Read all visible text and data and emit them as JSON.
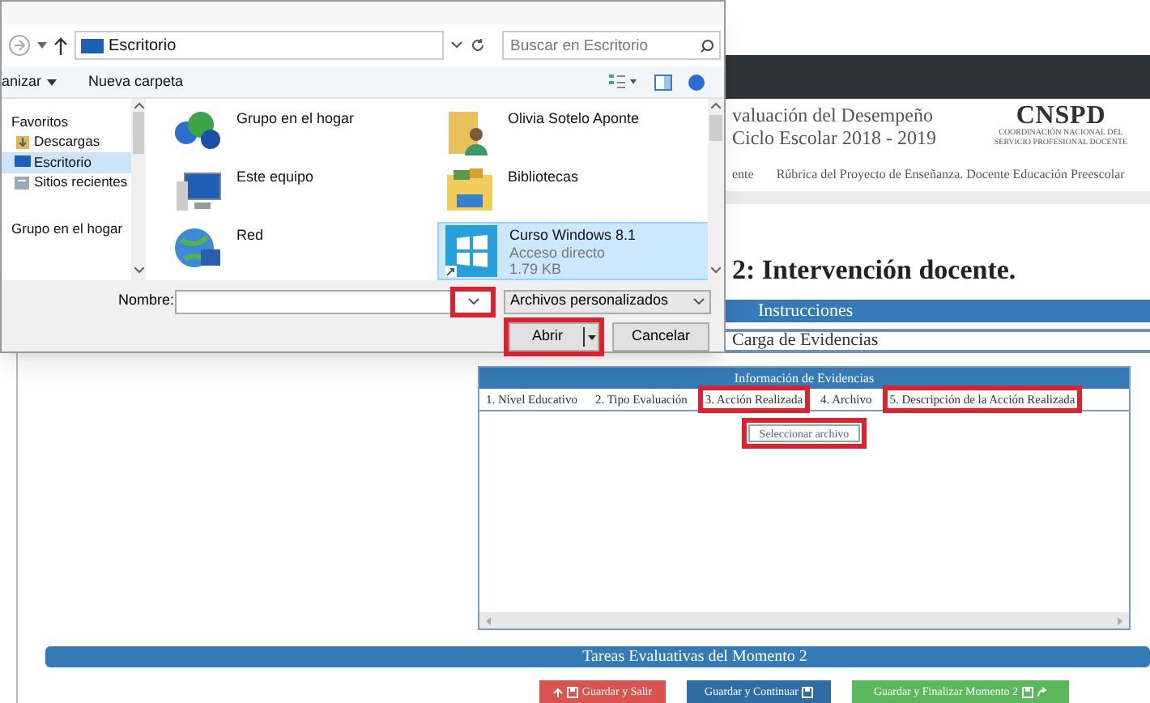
{
  "dialog": {
    "address": "Escritorio",
    "search": {
      "placeholder": "Buscar en Escritorio"
    },
    "toolbar": [
      "anizar",
      "Nueva carpeta"
    ],
    "nav_pane": [
      {
        "label": "Favoritos",
        "kind": "group",
        "selected": false
      },
      {
        "label": "Descargas",
        "kind": "download",
        "selected": false
      },
      {
        "label": "Escritorio",
        "kind": "desktop",
        "selected": true
      },
      {
        "label": "Sitios recientes",
        "kind": "recent",
        "selected": false
      },
      {
        "label": "Grupo en el hogar",
        "kind": "group",
        "selected": false
      }
    ],
    "files": [
      {
        "name": "Grupo en el hogar",
        "kind": "homegroup",
        "selected": false
      },
      {
        "name": "Olivia Sotelo Aponte",
        "kind": "user",
        "selected": false
      },
      {
        "name": "Este equipo",
        "kind": "computer",
        "selected": false
      },
      {
        "name": "Bibliotecas",
        "kind": "library",
        "selected": false
      },
      {
        "name": "Red",
        "kind": "network",
        "selected": false
      },
      {
        "name": "Curso Windows 8.1",
        "details": [
          "Acceso directo",
          "1.79 KB"
        ],
        "kind": "shortcut",
        "selected": true
      }
    ],
    "filename": {
      "label": "Nombre:",
      "dropdown_highlighted": true
    },
    "file_type": "Archivos personalizados",
    "buttons": [
      {
        "label": "Abrir",
        "kind": "split",
        "highlighted": true
      },
      {
        "label": "Cancelar",
        "kind": "plain",
        "highlighted": false
      }
    ]
  },
  "page": {
    "title_lines": [
      "valuación del Desempeño",
      "Ciclo Escolar 2018 - 2019"
    ],
    "logo": {
      "title": "CNSPD",
      "subtitle": [
        "COORDINACIÓN NACIONAL DEL",
        "SERVICIO PROFESIONAL DOCENTE"
      ]
    },
    "nav": [
      "ente",
      "Rúbrica del Proyecto de Enseñanza. Docente Educación Preescolar"
    ],
    "heading": "2: Intervención docente.",
    "sections": [
      {
        "label": "Instrucciones",
        "kind": "bar"
      },
      {
        "label": "Carga de Evidencias",
        "kind": "outline"
      }
    ],
    "evidence": {
      "title": "Información de Evidencias",
      "columns": [
        {
          "label": "1. Nivel Educativo",
          "highlighted": false
        },
        {
          "label": "2. Tipo Evaluación",
          "highlighted": false
        },
        {
          "label": "3. Acción Realizada",
          "highlighted": true
        },
        {
          "label": "4. Archivo",
          "highlighted": false
        },
        {
          "label": "5. Descripción de la Acción Realizada",
          "highlighted": true
        }
      ],
      "action": {
        "label": "Seleccionar archivo",
        "highlighted": true
      }
    },
    "tasks_title": "Tareas Evaluativas del Momento 2",
    "actions": [
      {
        "label": "Guardar y Salir",
        "kind": "danger"
      },
      {
        "label": "Guardar y Continuar",
        "kind": "primary"
      },
      {
        "label": "Guardar y Finalizar Momento 2",
        "kind": "success"
      }
    ]
  }
}
